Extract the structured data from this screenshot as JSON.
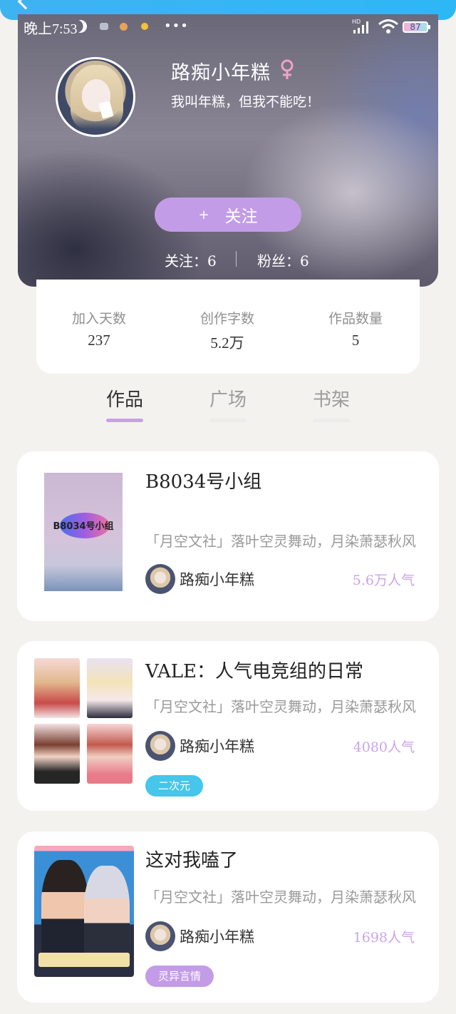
{
  "status_bar": {
    "time": "晚上7:53",
    "hd": "HD",
    "battery": "87",
    "more": "•••"
  },
  "profile": {
    "name": "路痴小年糕",
    "gender_symbol": "♀",
    "bio": "我叫年糕，但我不能吃！",
    "follow_button": "关注",
    "follow_plus": "+",
    "following": "关注：6",
    "fans": "粉丝：6"
  },
  "stats": [
    {
      "label": "加入天数",
      "value": "237"
    },
    {
      "label": "创作字数",
      "value": "5.2万"
    },
    {
      "label": "作品数量",
      "value": "5"
    }
  ],
  "tabs": [
    {
      "label": "作品",
      "active": true
    },
    {
      "label": "广场",
      "active": false
    },
    {
      "label": "书架",
      "active": false
    }
  ],
  "works": [
    {
      "title": "B8034号小组",
      "cover_text": "B8034号小组",
      "desc": "「月空文社」落叶空灵舞动，月染萧瑟秋风",
      "author": "路痴小年糕",
      "popularity": "5.6万人气",
      "tag": ""
    },
    {
      "title": "VALE：人气电竞组的日常",
      "desc": "「月空文社」落叶空灵舞动，月染萧瑟秋风",
      "author": "路痴小年糕",
      "popularity": "4080人气",
      "tag": "二次元",
      "tag_color": "#45c6ea"
    },
    {
      "title": "这对我嗑了",
      "desc": "「月空文社」落叶空灵舞动，月染萧瑟秋风",
      "author": "路痴小年糕",
      "popularity": "1698人气",
      "tag": "灵异言情",
      "tag_color": "#c39ce8"
    }
  ],
  "colors": {
    "accent": "#c39ce8",
    "popularity": "#c9a4ec",
    "top_strip": "#2eb7f5"
  }
}
